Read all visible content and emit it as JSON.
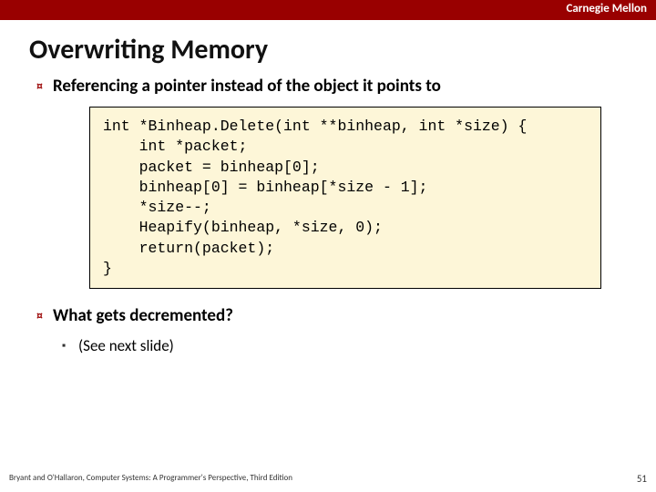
{
  "header": {
    "brand": "Carnegie Mellon"
  },
  "title": "Overwriting Memory",
  "bullets": {
    "b1": "Referencing a pointer instead of the object it points to",
    "b2": "What gets decremented?",
    "sub1": "(See next slide)"
  },
  "code": "int *Binheap.Delete(int **binheap, int *size) {\n    int *packet;\n    packet = binheap[0];\n    binheap[0] = binheap[*size - 1];\n    *size--;\n    Heapify(binheap, *size, 0);\n    return(packet);\n}",
  "footer": {
    "left": "Bryant and O'Hallaron, Computer Systems: A Programmer's Perspective, Third Edition",
    "page": "51"
  }
}
